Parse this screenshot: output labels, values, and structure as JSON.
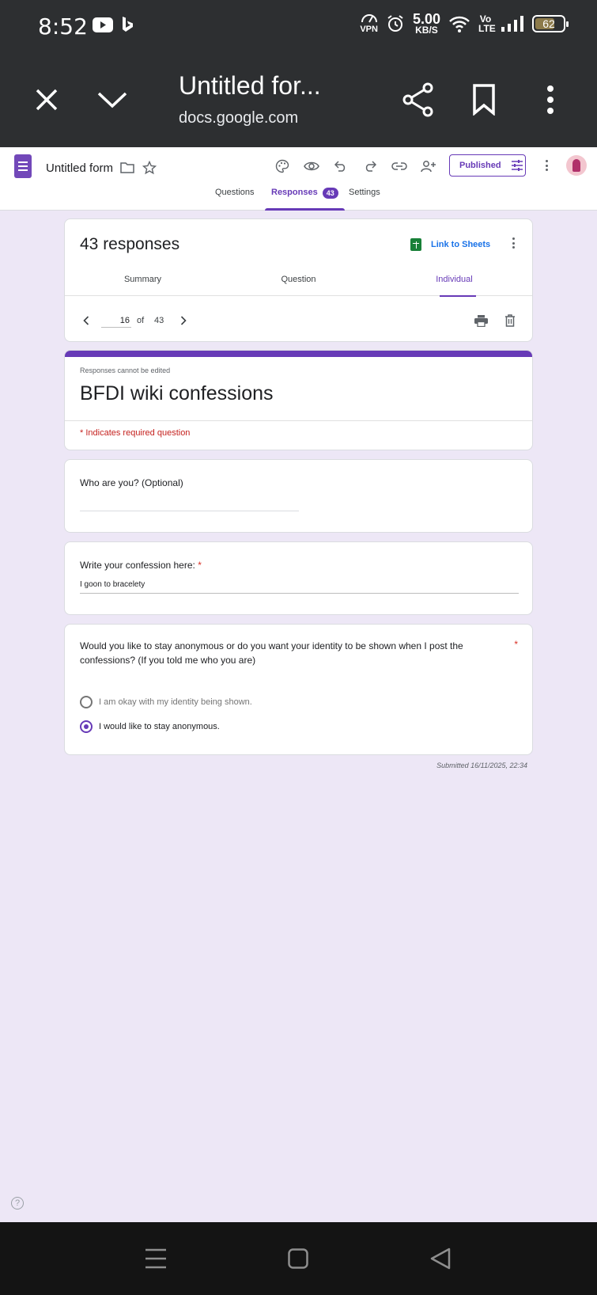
{
  "status_bar": {
    "time": "8:52",
    "vpn_label": "VPN",
    "speed_value": "5.00",
    "speed_unit": "KB/S",
    "volte_label": "Vo LTE",
    "battery_percent": "62"
  },
  "custom_tab": {
    "title": "Untitled for...",
    "url": "docs.google.com"
  },
  "app_header": {
    "form_title": "Untitled form",
    "published_label": "Published",
    "tabs": [
      {
        "label": "Questions"
      },
      {
        "label": "Responses",
        "badge": "43"
      },
      {
        "label": "Settings"
      }
    ]
  },
  "responses": {
    "title": "43 responses",
    "link_to_sheets_label": "Link to Sheets",
    "sub_tabs": [
      {
        "label": "Summary"
      },
      {
        "label": "Question"
      },
      {
        "label": "Individual"
      }
    ],
    "current_response": "16",
    "of_label": "of",
    "total": "43"
  },
  "form": {
    "not_edited_notice": "Responses cannot be edited",
    "name": "BFDI wiki confessions",
    "required_note": "* Indicates required question",
    "questions": [
      {
        "label": "Who are you? (Optional)",
        "answer": ""
      },
      {
        "label": "Write your confession here:",
        "required_mark": "*",
        "answer": "I goon to bracelety"
      },
      {
        "label": "Would you like to stay anonymous or do you want your identity to be shown when I post the confessions? (If you told me who you are)",
        "required_mark": "*",
        "options": [
          {
            "label": "I am okay with my identity being shown.",
            "selected": false
          },
          {
            "label": "I would like to stay anonymous.",
            "selected": true
          }
        ]
      }
    ],
    "submitted": "Submitted 16/11/2025, 22:34"
  },
  "help_label": "?",
  "colors": {
    "accent": "#673ab7",
    "background": "#ede7f6",
    "required": "#d93025",
    "sheets_link": "#1a73e8"
  },
  "icons": [
    "youtube-icon",
    "bing-icon",
    "alarm-icon",
    "wifi-icon",
    "signal-icon",
    "close-icon",
    "chevron-down-icon",
    "share-icon",
    "bookmark-icon",
    "more-vert-icon",
    "palette-icon",
    "preview-eye-icon",
    "undo-icon",
    "redo-icon",
    "link-icon",
    "add-collaborator-icon",
    "tune-icon",
    "folder-icon",
    "star-icon",
    "print-icon",
    "delete-icon",
    "chevron-left-icon",
    "chevron-right-icon",
    "help-icon",
    "recents-icon",
    "home-icon",
    "back-icon"
  ]
}
